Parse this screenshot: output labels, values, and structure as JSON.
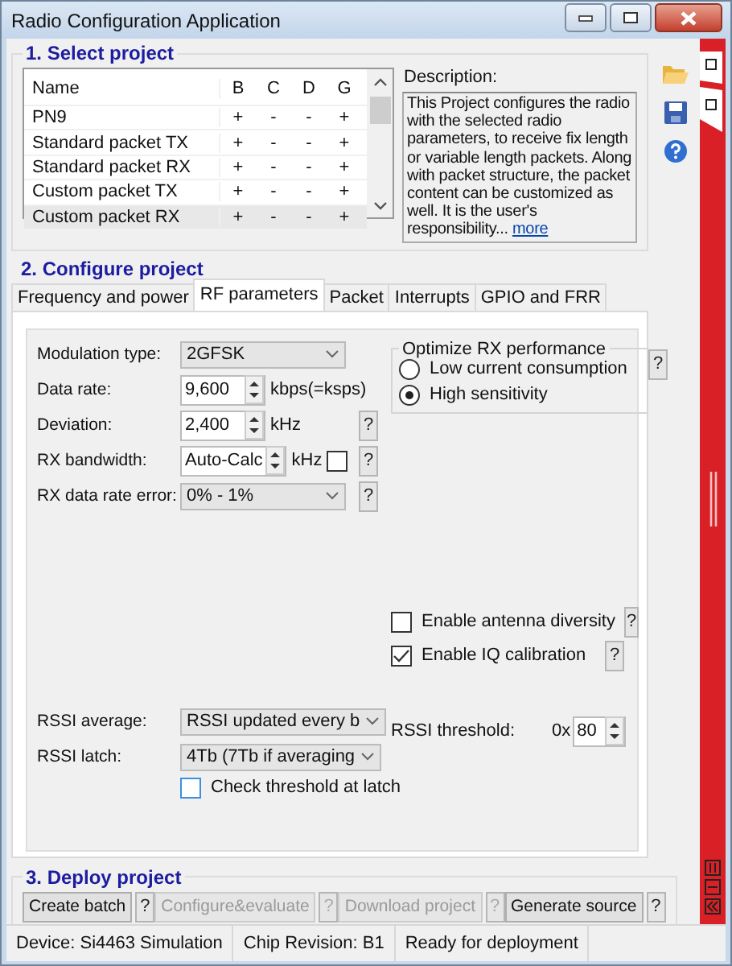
{
  "window": {
    "title": "Radio Configuration Application"
  },
  "select_project": {
    "title": "1. Select project",
    "columns": [
      "Name",
      "B",
      "C",
      "D",
      "G"
    ],
    "rows": [
      {
        "cells": [
          "PN9",
          "+",
          "-",
          "-",
          "+"
        ],
        "selected": false
      },
      {
        "cells": [
          "Standard packet TX",
          "+",
          "-",
          "-",
          "+"
        ],
        "selected": false
      },
      {
        "cells": [
          "Standard packet RX",
          "+",
          "-",
          "-",
          "+"
        ],
        "selected": false
      },
      {
        "cells": [
          "Custom packet TX",
          "+",
          "-",
          "-",
          "+"
        ],
        "selected": false
      },
      {
        "cells": [
          "Custom packet RX",
          "+",
          "-",
          "-",
          "+"
        ],
        "selected": true
      }
    ],
    "description_label": "Description:",
    "description": "This Project configures the radio with the selected radio parameters, to receive fix length or variable length packets. Along with packet structure, the packet content can be customized as well. It is the user's responsibility...",
    "more_link": "more"
  },
  "configure_project": {
    "title": "2. Configure project",
    "tabs": [
      {
        "label": "Frequency and power",
        "selected": false
      },
      {
        "label": "RF parameters",
        "selected": true
      },
      {
        "label": "Packet",
        "selected": false
      },
      {
        "label": "Interrupts",
        "selected": false
      },
      {
        "label": "GPIO and FRR",
        "selected": false
      }
    ],
    "fields": [
      {
        "kind": "dropdown",
        "label": "Modulation type:",
        "value": "2GFSK"
      },
      {
        "kind": "spinner",
        "label": "Data rate:",
        "value": "9,600",
        "unit": "kbps(=ksps)"
      },
      {
        "kind": "spinner",
        "label": "Deviation:",
        "value": "2,400",
        "unit": "kHz",
        "help": "?"
      },
      {
        "kind": "spinner",
        "label": "RX bandwidth:",
        "value": "Auto-Calc",
        "unit": "kHz",
        "unit_checked": false,
        "help": "?"
      },
      {
        "kind": "narrow_dropdown",
        "label": "RX data rate error:",
        "value": "0% - 1%",
        "help": "?"
      }
    ],
    "rx_performance": {
      "title": "Optimize RX performance",
      "help": "?",
      "options": [
        {
          "label": "Low current consumption",
          "selected": false
        },
        {
          "label": "High sensitivity",
          "selected": true
        }
      ]
    },
    "options": [
      {
        "label": "Enable antenna diversity",
        "checked": false,
        "help": "?"
      },
      {
        "label": "Enable IQ calibration",
        "checked": true,
        "help": "?"
      }
    ],
    "rssi_average": {
      "label": "RSSI average:",
      "value": "RSSI updated every b"
    },
    "rssi_latch": {
      "label": "RSSI latch:",
      "value": "4Tb (7Tb if averaging"
    },
    "check_threshold": {
      "label": "Check threshold at latch",
      "checked": false
    },
    "rssi_threshold": {
      "label": "RSSI threshold:",
      "prefix": "0x",
      "value": "80"
    }
  },
  "deploy_project": {
    "title": "3. Deploy project",
    "buttons": [
      {
        "label": "Create batch",
        "disabled": false,
        "help": "?"
      },
      {
        "label": "Configure&evaluate",
        "disabled": true,
        "help": "?"
      },
      {
        "label": "Download project",
        "disabled": true,
        "help": "?"
      },
      {
        "label": "Generate source",
        "disabled": false,
        "help": "?"
      }
    ]
  },
  "status_bar": [
    "Device: Si4463  Simulation",
    "Chip Revision: B1",
    "Ready for deployment"
  ]
}
